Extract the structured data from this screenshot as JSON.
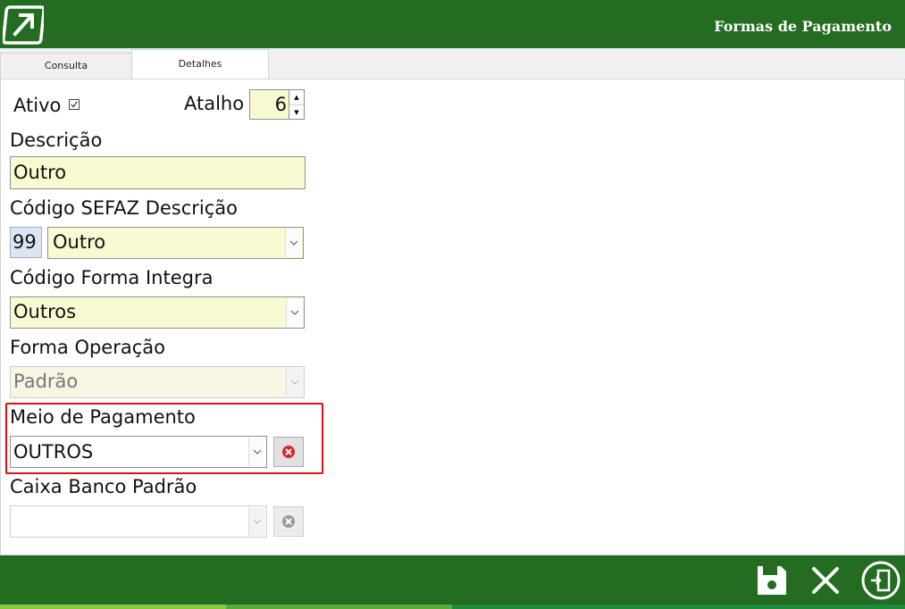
{
  "header": {
    "title": "Formas de Pagamento",
    "logo_icon": "arrow-logo-icon"
  },
  "tabs": [
    {
      "label": "Consulta"
    },
    {
      "label": "Detalhes"
    }
  ],
  "form": {
    "ativo_label": "Ativo",
    "ativo_checked": true,
    "atalho_label": "Atalho",
    "atalho_value": "6",
    "descricao_label": "Descrição",
    "descricao_value": "Outro",
    "sefaz_label": "Código SEFAZ Descrição",
    "sefaz_code": "99",
    "sefaz_desc": "Outro",
    "integra_label": "Código Forma Integra",
    "integra_value": "Outros",
    "operacao_label": "Forma Operação",
    "operacao_value": "Padrão",
    "meio_label": "Meio de Pagamento",
    "meio_value": "OUTROS",
    "caixa_label": "Caixa Banco Padrão",
    "caixa_value": ""
  },
  "footer": {
    "icons": [
      "save-icon",
      "cancel-icon",
      "exit-icon"
    ]
  },
  "colors": {
    "header_green": "#236c22",
    "field_yellow": "#fafad2",
    "highlight_red": "#e01010"
  }
}
